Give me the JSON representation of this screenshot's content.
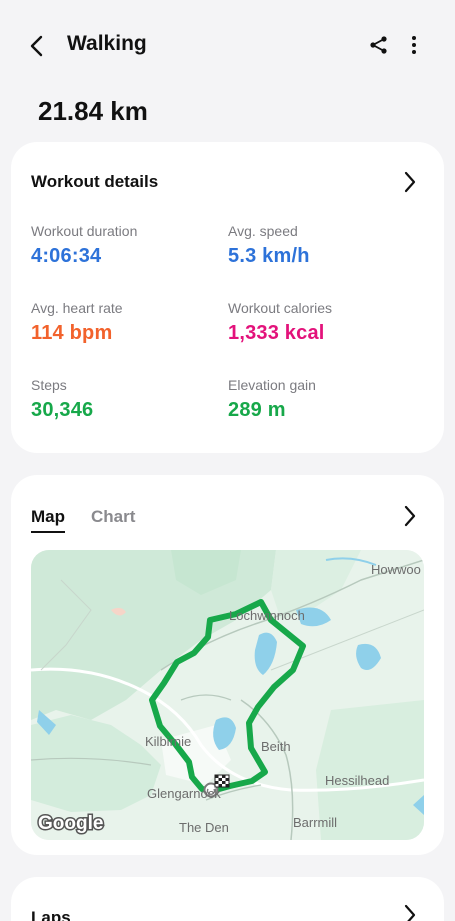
{
  "header": {
    "title": "Walking",
    "back_icon": "chevron-left-icon",
    "share_icon": "share-icon",
    "more_icon": "more-vertical-icon"
  },
  "summary": {
    "distance": "21.84 km"
  },
  "workout_details": {
    "title": "Workout details",
    "stats": {
      "duration": {
        "label": "Workout duration",
        "value": "4:06:34",
        "color": "#2d72d9"
      },
      "speed": {
        "label": "Avg. speed",
        "value": "5.3 km/h",
        "color": "#2d72d9"
      },
      "heart_rate": {
        "label": "Avg. heart rate",
        "value": "114 bpm",
        "color": "#f2622c"
      },
      "calories": {
        "label": "Workout calories",
        "value": "1,333 kcal",
        "color": "#e3127b"
      },
      "steps": {
        "label": "Steps",
        "value": "30,346",
        "color": "#17a84a"
      },
      "elevation": {
        "label": "Elevation gain",
        "value": "289 m",
        "color": "#17a84a"
      }
    }
  },
  "map_section": {
    "tabs": [
      {
        "label": "Map",
        "selected": true
      },
      {
        "label": "Chart",
        "selected": false
      }
    ],
    "map": {
      "labels": {
        "howwood": "Howwoo",
        "lochwinnoch": "Lochwinnoch",
        "kilbirnie": "Kilbirnie",
        "beith": "Beith",
        "hessilhead": "Hessilhead",
        "glengarnock": "Glengarnock",
        "the_den": "The Den",
        "barrmill": "Barrmill"
      },
      "attribution": "Google",
      "route_color": "#17a84a"
    }
  },
  "laps": {
    "title": "Laps"
  }
}
